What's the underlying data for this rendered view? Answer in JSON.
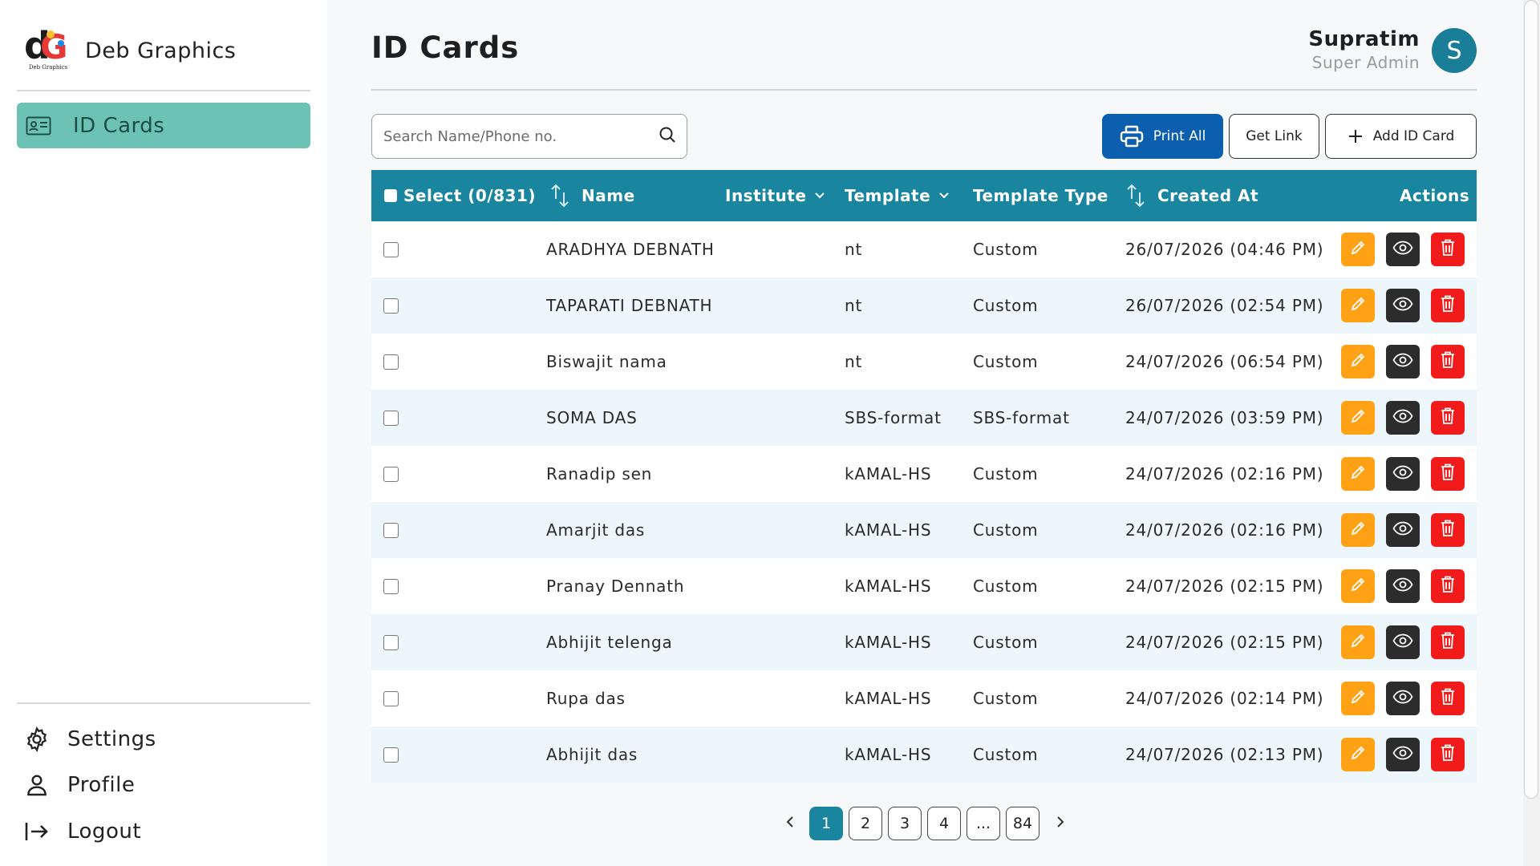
{
  "brand": {
    "name": "Deb Graphics",
    "logo_caption": "Deb Graphics"
  },
  "sidebar": {
    "active_item": {
      "label": "ID Cards",
      "icon": "id-card-icon"
    },
    "bottom_items": [
      {
        "label": "Settings",
        "icon": "gear-icon"
      },
      {
        "label": "Profile",
        "icon": "user-icon"
      },
      {
        "label": "Logout",
        "icon": "logout-icon"
      }
    ]
  },
  "header": {
    "title": "ID Cards",
    "user": {
      "name": "Supratim",
      "role": "Super Admin",
      "initial": "S"
    }
  },
  "toolbar": {
    "search_placeholder": "Search Name/Phone no.",
    "print_all": "Print All",
    "get_link": "Get Link",
    "add_id_card": "Add ID Card"
  },
  "table": {
    "headers": {
      "select": "Select (0/831)",
      "name": "Name",
      "institute": "Institute",
      "template": "Template",
      "template_type": "Template Type",
      "created_at": "Created At",
      "actions": "Actions"
    },
    "rows": [
      {
        "name": "ARADHYA DEBNATH",
        "template": "nt",
        "template_type": "Custom",
        "created_at": "26/07/2026 (04:46 PM)"
      },
      {
        "name": "TAPARATI DEBNATH",
        "template": "nt",
        "template_type": "Custom",
        "created_at": "26/07/2026 (02:54 PM)"
      },
      {
        "name": "Biswajit nama",
        "template": "nt",
        "template_type": "Custom",
        "created_at": "24/07/2026 (06:54 PM)"
      },
      {
        "name": "SOMA DAS",
        "template": "SBS-format",
        "template_type": "SBS-format",
        "created_at": "24/07/2026 (03:59 PM)"
      },
      {
        "name": "Ranadip sen",
        "template": "kAMAL-HS",
        "template_type": "Custom",
        "created_at": "24/07/2026 (02:16 PM)"
      },
      {
        "name": "Amarjit das",
        "template": "kAMAL-HS",
        "template_type": "Custom",
        "created_at": "24/07/2026 (02:16 PM)"
      },
      {
        "name": "Pranay Dennath",
        "template": "kAMAL-HS",
        "template_type": "Custom",
        "created_at": "24/07/2026 (02:15 PM)"
      },
      {
        "name": "Abhijit telenga",
        "template": "kAMAL-HS",
        "template_type": "Custom",
        "created_at": "24/07/2026 (02:15 PM)"
      },
      {
        "name": "Rupa das",
        "template": "kAMAL-HS",
        "template_type": "Custom",
        "created_at": "24/07/2026 (02:14 PM)"
      },
      {
        "name": "Abhijit das",
        "template": "kAMAL-HS",
        "template_type": "Custom",
        "created_at": "24/07/2026 (02:13 PM)"
      }
    ]
  },
  "pagination": {
    "pages": [
      "1",
      "2",
      "3",
      "4",
      "...",
      "84"
    ],
    "current": "1"
  },
  "colors": {
    "header_bg": "#1a859f",
    "active_nav": "#6cc3b5",
    "print_button": "#0c5fae",
    "edit": "#ffa114",
    "view": "#2c2c2c",
    "delete": "#f21b1b",
    "avatar": "#1b7e99"
  }
}
